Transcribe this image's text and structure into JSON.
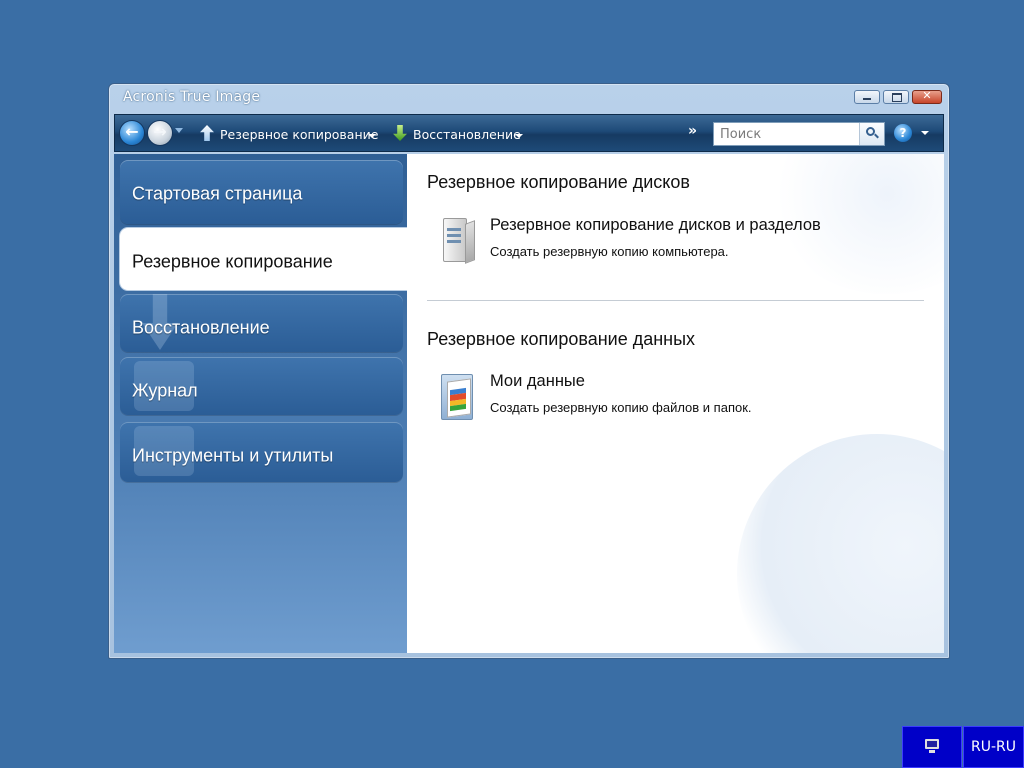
{
  "window": {
    "title": "Acronis True Image",
    "buttons": {
      "minimize_icon": "minimize-icon",
      "maximize_icon": "maximize-icon",
      "close_icon": "close-icon"
    }
  },
  "toolbar": {
    "back_icon": "back-arrow-icon",
    "forward_icon": "forward-arrow-icon",
    "backup_label": "Резервное копирование",
    "restore_label": "Восстановление",
    "more_glyph": "»",
    "search_placeholder": "Поиск",
    "help_glyph": "?"
  },
  "sidebar": {
    "items": [
      {
        "label": "Стартовая страница",
        "active": false
      },
      {
        "label": "Резервное копирование",
        "active": true
      },
      {
        "label": "Восстановление",
        "active": false
      },
      {
        "label": "Журнал",
        "active": false
      },
      {
        "label": "Инструменты и утилиты",
        "active": false
      }
    ]
  },
  "content": {
    "sections": [
      {
        "title": "Резервное копирование дисков",
        "task": {
          "title": "Резервное копирование дисков и разделов",
          "description": "Создать резервную копию компьютера.",
          "icon": "server-icon"
        }
      },
      {
        "title": "Резервное копирование данных",
        "task": {
          "title": "Мои данные",
          "description": "Создать резервную копию файлов и папок.",
          "icon": "documents-folder-icon"
        }
      }
    ]
  },
  "tray": {
    "display_icon": "monitor-icon",
    "language": "RU-RU"
  },
  "colors": {
    "desktop": "#3a6ea5",
    "sidebar": "#2f5f95",
    "tray": "#0000c8"
  }
}
